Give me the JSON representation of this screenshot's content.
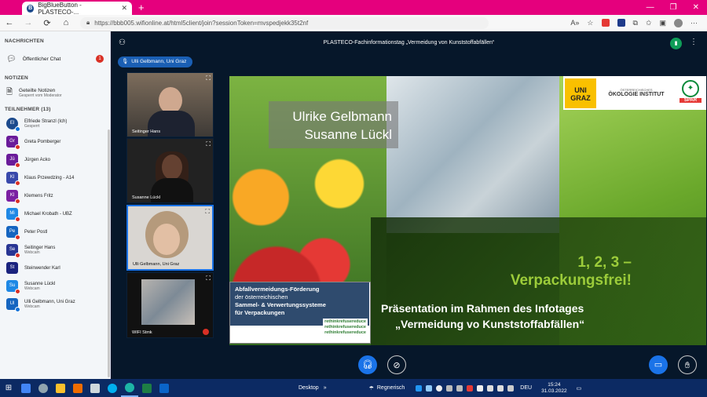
{
  "browser": {
    "tab_title": "BigBlueButton - PLASTECO-...",
    "tab_favicon": "B",
    "new_tab": "+",
    "url": "https://bbb005.wifionline.at/html5client/join?sessionToken=mvspedjekk35t2nf"
  },
  "sidebar": {
    "messages_header": "NACHRICHTEN",
    "public_chat": "Öffentlicher Chat",
    "public_chat_badge": "1",
    "notes_header": "NOTIZEN",
    "shared_notes": "Geteilte Notizen",
    "shared_notes_sub": "Gesperrt vom Moderator",
    "participants_header": "TEILNEHMER (13)",
    "users": [
      {
        "initials": "El",
        "name": "Elfriede Stranzl (Ich)",
        "sub": "Gesperrt",
        "color": "#1c4a8c",
        "round": true,
        "mic": "b"
      },
      {
        "initials": "Gr",
        "name": "Greta Pomberger",
        "sub": "",
        "color": "#6a1b9a",
        "round": false,
        "mic": "r"
      },
      {
        "initials": "Jü",
        "name": "Jürgen Acko",
        "sub": "",
        "color": "#6a1b9a",
        "round": false,
        "mic": "r"
      },
      {
        "initials": "Kl",
        "name": "Klaus Przewdzing - A14",
        "sub": "",
        "color": "#3949ab",
        "round": false,
        "mic": "r"
      },
      {
        "initials": "Kl",
        "name": "Klemens Fritz",
        "sub": "",
        "color": "#7b1fa2",
        "round": false,
        "mic": "r"
      },
      {
        "initials": "Mi",
        "name": "Michael Krobath - UBZ",
        "sub": "",
        "color": "#1e88e5",
        "round": false,
        "mic": "r"
      },
      {
        "initials": "Pe",
        "name": "Peter Postl",
        "sub": "",
        "color": "#1565c0",
        "round": false,
        "mic": "r"
      },
      {
        "initials": "Se",
        "name": "Seitinger Hans",
        "sub": "Webcam",
        "color": "#283593",
        "round": false,
        "mic": "r"
      },
      {
        "initials": "St",
        "name": "Steinwender Karl",
        "sub": "",
        "color": "#1a237e",
        "round": false,
        "mic": ""
      },
      {
        "initials": "Su",
        "name": "Susanne Lückl",
        "sub": "Webcam",
        "color": "#1e88e5",
        "round": false,
        "mic": "r"
      },
      {
        "initials": "Ul",
        "name": "Ulli Gelbmann, Uni Graz",
        "sub": "Webcam",
        "color": "#1565c0",
        "round": false,
        "mic": "b"
      }
    ]
  },
  "main": {
    "meeting_title": "PLASTECO-Fachinformationstag „Vermeidung von Kunststoffabfällen“",
    "current_speaker": "Ulli Gelbmann, Uni Graz",
    "videos": [
      {
        "label": "Seitinger Hans"
      },
      {
        "label": "Susanne Lückl"
      },
      {
        "label": "Ulli Gelbmann, Uni Graz"
      },
      {
        "label": "WIFI Stmk"
      }
    ]
  },
  "slide": {
    "speaker1": "Ulrike Gelbmann",
    "speaker2": "Susanne Lückl",
    "headline1": "1, 2, 3 –",
    "headline2": "Verpackungsfrei!",
    "subtitle1": "Präsentation im Rahmen des Infotages",
    "subtitle2": "„Vermeidung vo Kunststoffabfällen“",
    "box_line1": "Abfallvermeidungs-Förderung",
    "box_line2": "der österreichischen",
    "box_line3": "Sammel- & Verwertungssysteme",
    "box_line4": "für Verpackungen",
    "rethink1": "rethinkrefusereduce",
    "rethink2": "rethinkrefusereduce",
    "rethink3": "rethinkrefusereduce",
    "logo_uni1": "UNI",
    "logo_uni2": "GRAZ",
    "logo_oeko_small": "ÖSTERREICHISCHES",
    "logo_oeko": "ÖKOLOGIE INSTITUT",
    "logo_spar": "SPAR"
  },
  "taskbar": {
    "desktop": "Desktop",
    "weather": "Regnerisch",
    "lang": "DEU",
    "time": "15:24",
    "date": "31.03.2022"
  }
}
